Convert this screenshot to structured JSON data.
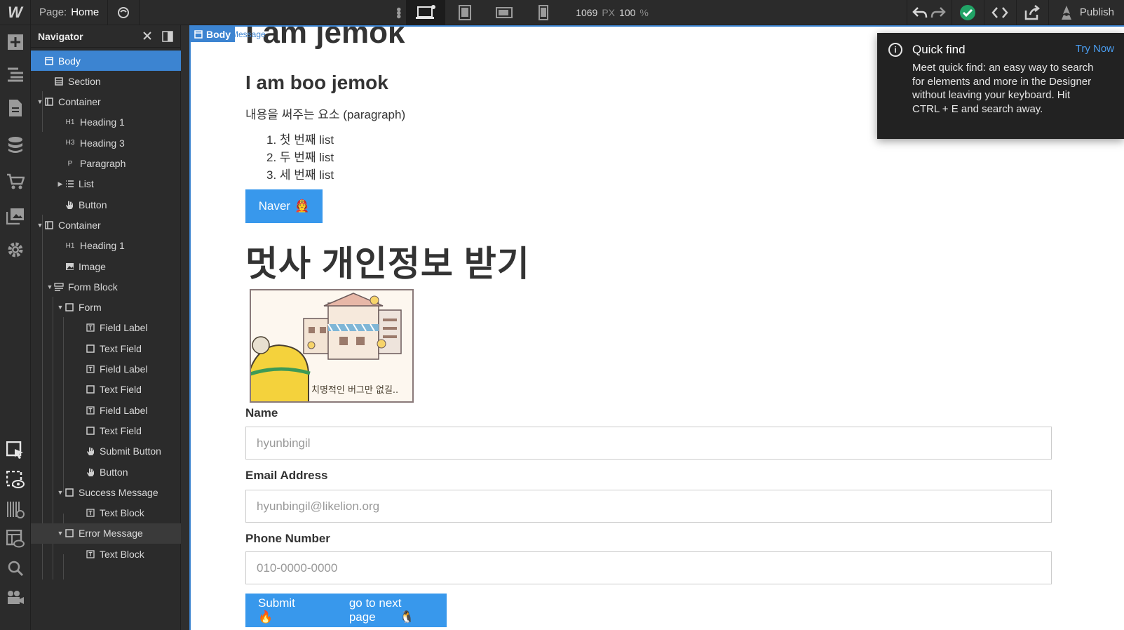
{
  "topbar": {
    "logo": "W",
    "page_label": "Page:",
    "page_name": "Home",
    "width_value": "1069",
    "width_unit": "PX",
    "zoom_value": "100",
    "zoom_unit": "%",
    "publish_label": "Publish",
    "accent": "#3c84d1",
    "status_color": "#21a366"
  },
  "navigator": {
    "title": "Navigator",
    "items": [
      {
        "label": "Body",
        "icon": "body-icon"
      },
      {
        "label": "Section",
        "icon": "section-icon"
      },
      {
        "label": "Container",
        "icon": "container-icon"
      },
      {
        "label": "Heading 1",
        "icon": "heading-icon",
        "tag": "H1"
      },
      {
        "label": "Heading 3",
        "icon": "heading-icon",
        "tag": "H3"
      },
      {
        "label": "Paragraph",
        "icon": "paragraph-icon",
        "tag": "P"
      },
      {
        "label": "List",
        "icon": "list-icon"
      },
      {
        "label": "Button",
        "icon": "hand-pointer-icon"
      },
      {
        "label": "Container",
        "icon": "container-icon"
      },
      {
        "label": "Heading 1",
        "icon": "heading-icon",
        "tag": "H1"
      },
      {
        "label": "Image",
        "icon": "image-icon"
      },
      {
        "label": "Form Block",
        "icon": "form-block-icon"
      },
      {
        "label": "Form",
        "icon": "form-icon"
      },
      {
        "label": "Field Label",
        "icon": "text-block-icon"
      },
      {
        "label": "Text Field",
        "icon": "box-icon"
      },
      {
        "label": "Field Label",
        "icon": "text-block-icon"
      },
      {
        "label": "Text Field",
        "icon": "box-icon"
      },
      {
        "label": "Field Label",
        "icon": "text-block-icon"
      },
      {
        "label": "Text Field",
        "icon": "box-icon"
      },
      {
        "label": "Submit Button",
        "icon": "hand-pointer-icon"
      },
      {
        "label": "Button",
        "icon": "hand-pointer-icon"
      },
      {
        "label": "Success Message",
        "icon": "box-icon"
      },
      {
        "label": "Text Block",
        "icon": "text-block-icon"
      },
      {
        "label": "Error Message",
        "icon": "box-icon"
      },
      {
        "label": "Text Block",
        "icon": "text-block-icon"
      }
    ]
  },
  "canvas": {
    "body_tag": "Body",
    "hidden_tag": "Message",
    "heading1": "I am jemok",
    "heading3": "I am boo jemok",
    "paragraph": "내용을 써주는 요소 (paragraph)",
    "list": [
      "1. 첫 번째 list",
      "2. 두 번째 list",
      "3. 세 번째 list"
    ],
    "naver_button": "Naver",
    "naver_emoji": "🧑‍🚒",
    "heading1b": "멋사 개인정보 받기",
    "image_caption": "치명적인 버그만 없길..",
    "form": {
      "name_label": "Name",
      "name_placeholder": "hyunbingil",
      "email_label": "Email Address",
      "email_placeholder": "hyunbingil@likelion.org",
      "phone_label": "Phone Number",
      "phone_placeholder": "010-0000-0000",
      "submit_label": "Submit",
      "submit_emoji": "🔥",
      "next_label": "go to next page",
      "next_emoji": "🐧"
    },
    "button_color": "#3898ec"
  },
  "toast": {
    "title": "Quick find",
    "action": "Try Now",
    "body": "Meet quick find: an easy way to search for elements and more in the Designer without leaving your keyboard. Hit CTRL + E and search away."
  }
}
